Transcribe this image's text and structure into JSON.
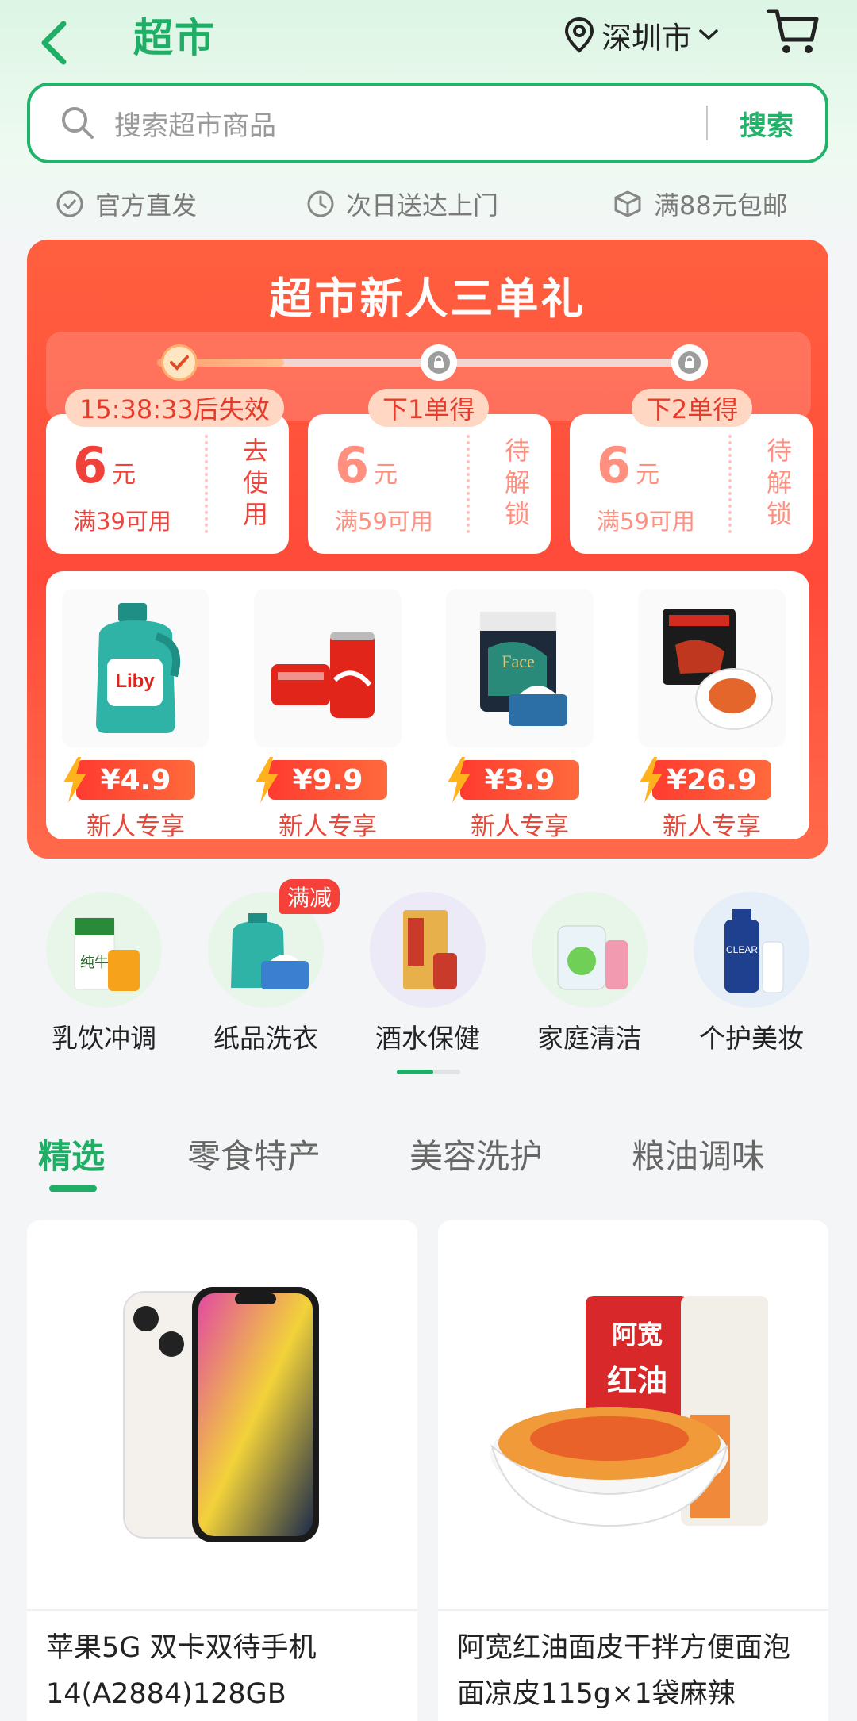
{
  "header": {
    "title": "超市",
    "location": "深圳市"
  },
  "search": {
    "placeholder": "搜索超市商品",
    "button": "搜索"
  },
  "benefits": [
    "官方直发",
    "次日送达上门",
    "满88元包邮"
  ],
  "promo": {
    "title": "超市新人三单礼",
    "coupons": [
      {
        "tag": "15:38:33后失效",
        "amount": "6",
        "unit": "元",
        "condition": "满39可用",
        "action": "去使用"
      },
      {
        "tag": "下1单得",
        "amount": "6",
        "unit": "元",
        "condition": "满59可用",
        "action": "待解锁"
      },
      {
        "tag": "下2单得",
        "amount": "6",
        "unit": "元",
        "condition": "满59可用",
        "action": "待解锁"
      }
    ],
    "products": [
      {
        "price": "¥4.9",
        "tag": "新人专享",
        "icon": "detergent-bottle-icon"
      },
      {
        "price": "¥9.9",
        "tag": "新人专享",
        "icon": "cola-can-icon"
      },
      {
        "price": "¥3.9",
        "tag": "新人专享",
        "icon": "tissue-pack-icon"
      },
      {
        "price": "¥26.9",
        "tag": "新人专享",
        "icon": "noodle-pack-icon"
      }
    ]
  },
  "categories": [
    {
      "label": "乳饮冲调"
    },
    {
      "label": "纸品洗衣",
      "badge": "满减"
    },
    {
      "label": "酒水保健"
    },
    {
      "label": "家庭清洁"
    },
    {
      "label": "个护美妆"
    }
  ],
  "tabs": [
    "精选",
    "零食特产",
    "美容洗护",
    "粮油调味"
  ],
  "feed": [
    {
      "title": "苹果5G 双卡双待手机 14(A2884)128GB",
      "icon": "smartphone-icon"
    },
    {
      "title": "阿宽红油面皮干拌方便面泡面凉皮115g×1袋麻辣",
      "icon": "noodle-bowl-icon"
    }
  ],
  "colors": {
    "accent": "#1fae66",
    "promo": "#ff4a3a",
    "price": "#ff3b30"
  }
}
